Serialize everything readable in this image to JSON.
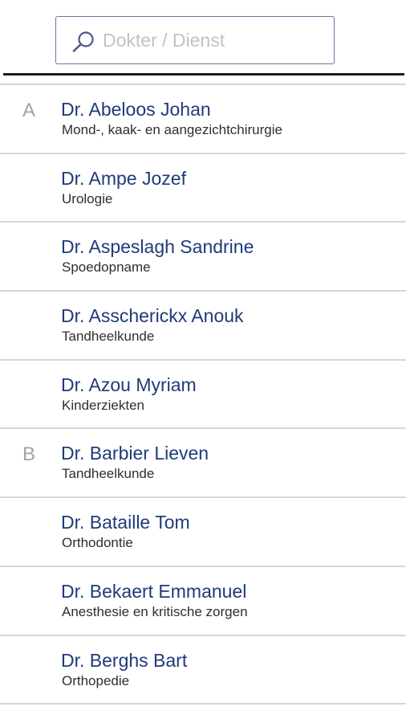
{
  "search": {
    "placeholder": "Dokter / Dienst",
    "value": ""
  },
  "colors": {
    "name": "#1f3a7a",
    "specialty": "#2e2e2e",
    "letter": "#a3a3a3",
    "search_border": "#6a759e"
  },
  "icons": {
    "search": "search-icon"
  },
  "doctors": [
    {
      "letter": "A",
      "name": "Dr. Abeloos Johan",
      "specialty": "Mond-, kaak- en aangezichtchirurgie"
    },
    {
      "letter": "",
      "name": "Dr. Ampe Jozef",
      "specialty": "Urologie"
    },
    {
      "letter": "",
      "name": "Dr. Aspeslagh Sandrine",
      "specialty": "Spoedopname"
    },
    {
      "letter": "",
      "name": "Dr. Asscherickx Anouk",
      "specialty": "Tandheelkunde"
    },
    {
      "letter": "",
      "name": "Dr. Azou Myriam",
      "specialty": "Kinderziekten"
    },
    {
      "letter": "B",
      "name": "Dr. Barbier Lieven",
      "specialty": "Tandheelkunde"
    },
    {
      "letter": "",
      "name": "Dr. Bataille Tom",
      "specialty": "Orthodontie"
    },
    {
      "letter": "",
      "name": "Dr. Bekaert Emmanuel",
      "specialty": "Anesthesie en kritische zorgen"
    },
    {
      "letter": "",
      "name": "Dr. Berghs Bart",
      "specialty": "Orthopedie"
    }
  ]
}
